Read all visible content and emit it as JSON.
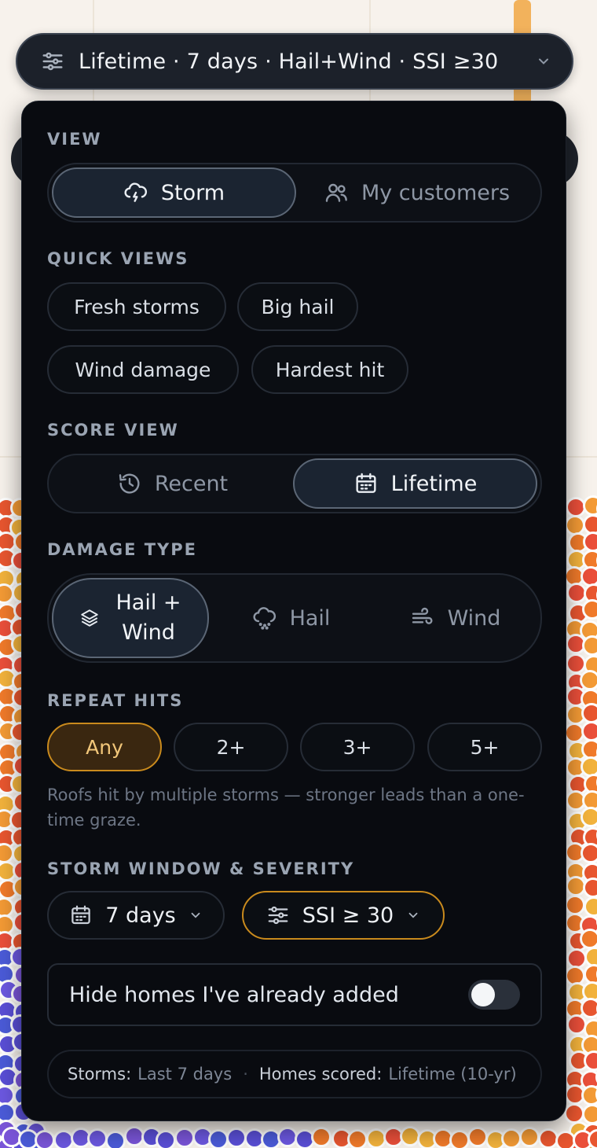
{
  "topbar": {
    "title": "Lifetime · 7 days · Hail+Wind · SSI ≥30",
    "icons": [
      "sliders-icon",
      "chevron-down-icon"
    ]
  },
  "view": {
    "label": "VIEW",
    "options": [
      {
        "label": "Storm",
        "icon": "storm-cloud-icon",
        "active": true
      },
      {
        "label": "My customers",
        "icon": "users-icon",
        "active": false
      }
    ]
  },
  "quick_views": {
    "label": "QUICK VIEWS",
    "chips": [
      "Fresh storms",
      "Big hail",
      "Wind damage",
      "Hardest hit"
    ]
  },
  "score_view": {
    "label": "SCORE VIEW",
    "options": [
      {
        "label": "Recent",
        "icon": "history-icon",
        "active": false
      },
      {
        "label": "Lifetime",
        "icon": "calendar-icon",
        "active": true
      }
    ]
  },
  "damage_type": {
    "label": "DAMAGE TYPE",
    "options": [
      {
        "label_line1": "Hail +",
        "label_line2": "Wind",
        "icon": "layers-icon",
        "active": true
      },
      {
        "label": "Hail",
        "icon": "hail-cloud-icon",
        "active": false
      },
      {
        "label": "Wind",
        "icon": "wind-icon",
        "active": false
      }
    ]
  },
  "repeat_hits": {
    "label": "REPEAT HITS",
    "options": [
      "Any",
      "2+",
      "3+",
      "5+"
    ],
    "selected": "Any",
    "hint": "Roofs hit by multiple storms — stronger leads than a one-time graze."
  },
  "storm_window": {
    "label": "STORM WINDOW & SEVERITY",
    "window_value": "7 days",
    "severity_value": "SSI ≥ 30"
  },
  "hide_added": {
    "label": "Hide homes I've already added",
    "enabled": false
  },
  "summary": {
    "storms_key": "Storms:",
    "storms_value": "Last 7 days",
    "separator": "·",
    "homes_key": "Homes scored:",
    "homes_value": "Lifetime (10-yr)"
  },
  "colors": {
    "panel_bg": "#090b10",
    "active_seg": "#1b2431",
    "amber_accent": "#c98a1d",
    "hint_text": "#6d7685"
  }
}
